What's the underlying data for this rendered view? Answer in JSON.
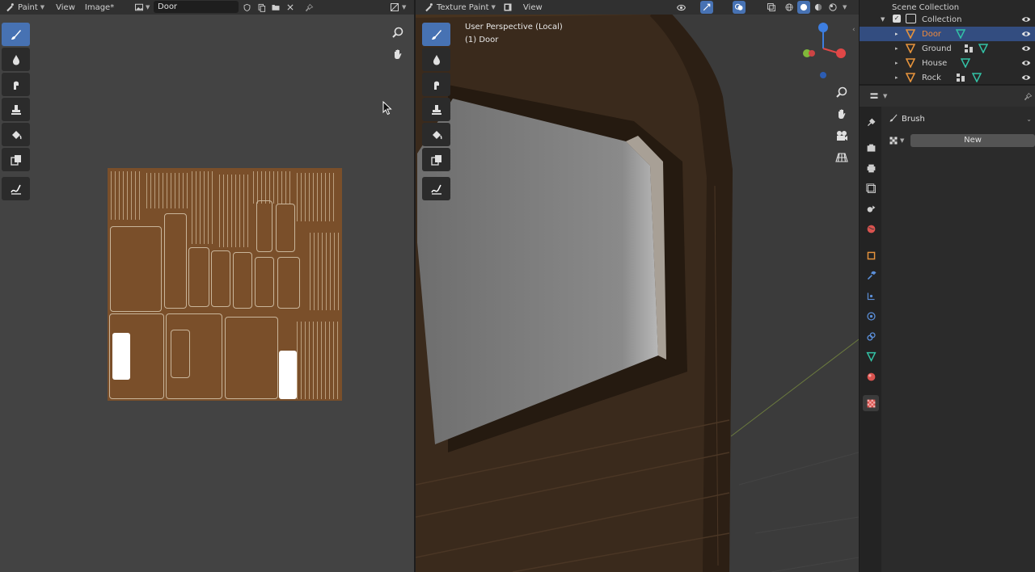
{
  "image_editor": {
    "header": {
      "mode_label": "Paint",
      "menu_view": "View",
      "menu_image": "Image*",
      "image_name": "Door"
    }
  },
  "viewport": {
    "header": {
      "mode_label": "Texture Paint",
      "menu_view": "View"
    },
    "overlay_line1": "User Perspective (Local)",
    "overlay_line2": "(1) Door"
  },
  "outliner": {
    "root": "Scene Collection",
    "collection": "Collection",
    "items": [
      {
        "name": "Door",
        "selected": true
      },
      {
        "name": "Ground",
        "selected": false
      },
      {
        "name": "House",
        "selected": false
      },
      {
        "name": "Rock",
        "selected": false
      }
    ]
  },
  "properties": {
    "panel_title": "Brush",
    "new_button": "New"
  },
  "colors": {
    "accent": "#4772b3",
    "selection": "#334d80",
    "mesh_icon": "#e6933c",
    "texture": "#7a4f2a"
  }
}
